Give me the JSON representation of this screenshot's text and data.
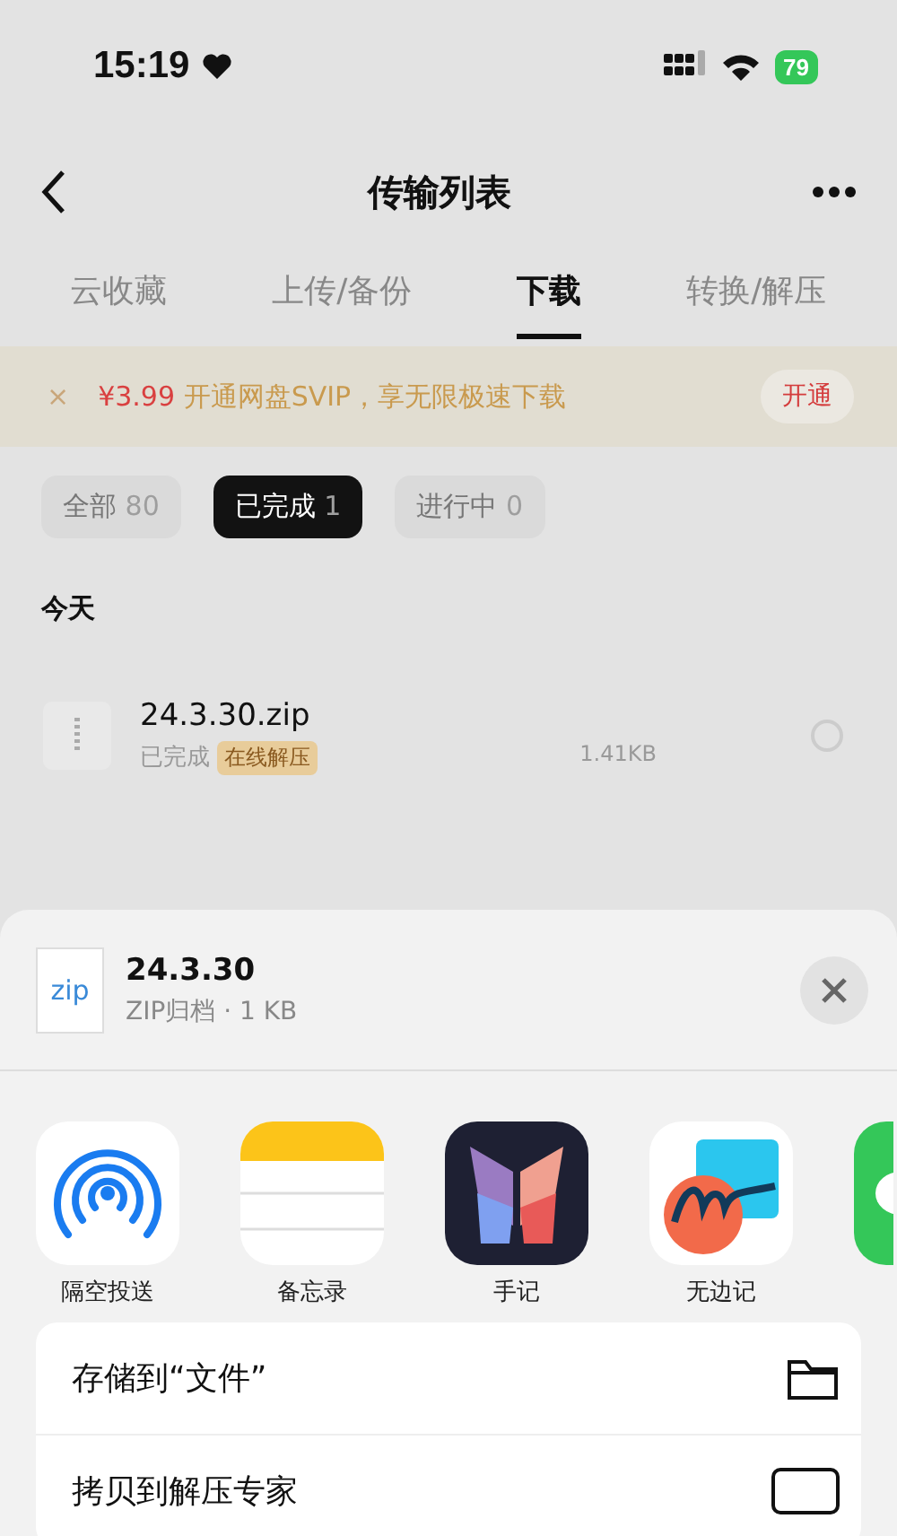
{
  "status_bar": {
    "time": "15:19",
    "battery": "79"
  },
  "nav": {
    "title": "传输列表"
  },
  "tabs": [
    {
      "label": "云收藏",
      "selected": false
    },
    {
      "label": "上传/备份",
      "selected": false
    },
    {
      "label": "下载",
      "selected": true
    },
    {
      "label": "转换/解压",
      "selected": false
    }
  ],
  "promo": {
    "close": "×",
    "price": "¥3.99",
    "text": "开通网盘SVIP，享无限极速下载",
    "button": "开通"
  },
  "filters": [
    {
      "label": "全部",
      "count": "80",
      "selected": false
    },
    {
      "label": "已完成",
      "count": "1",
      "selected": true
    },
    {
      "label": "进行中",
      "count": "0",
      "selected": false
    }
  ],
  "section_title": "今天",
  "files": [
    {
      "name": "24.3.30.zip",
      "status": "已完成",
      "action": "在线解压",
      "size": "1.41KB",
      "selected": false
    }
  ],
  "share_sheet": {
    "file_icon_text": "zip",
    "title": "24.3.30",
    "subtitle": "ZIP归档 · 1 KB",
    "apps": [
      {
        "kind": "airdrop",
        "label": "隔空投送"
      },
      {
        "kind": "notes",
        "label": "备忘录"
      },
      {
        "kind": "journal",
        "label": "手记"
      },
      {
        "kind": "freeform",
        "label": "无边记"
      },
      {
        "kind": "messages"
      }
    ],
    "actions": [
      {
        "kind": "folder",
        "label": "存储到“文件”"
      },
      {
        "kind": "zip",
        "label": "拷贝到解压专家"
      }
    ]
  }
}
